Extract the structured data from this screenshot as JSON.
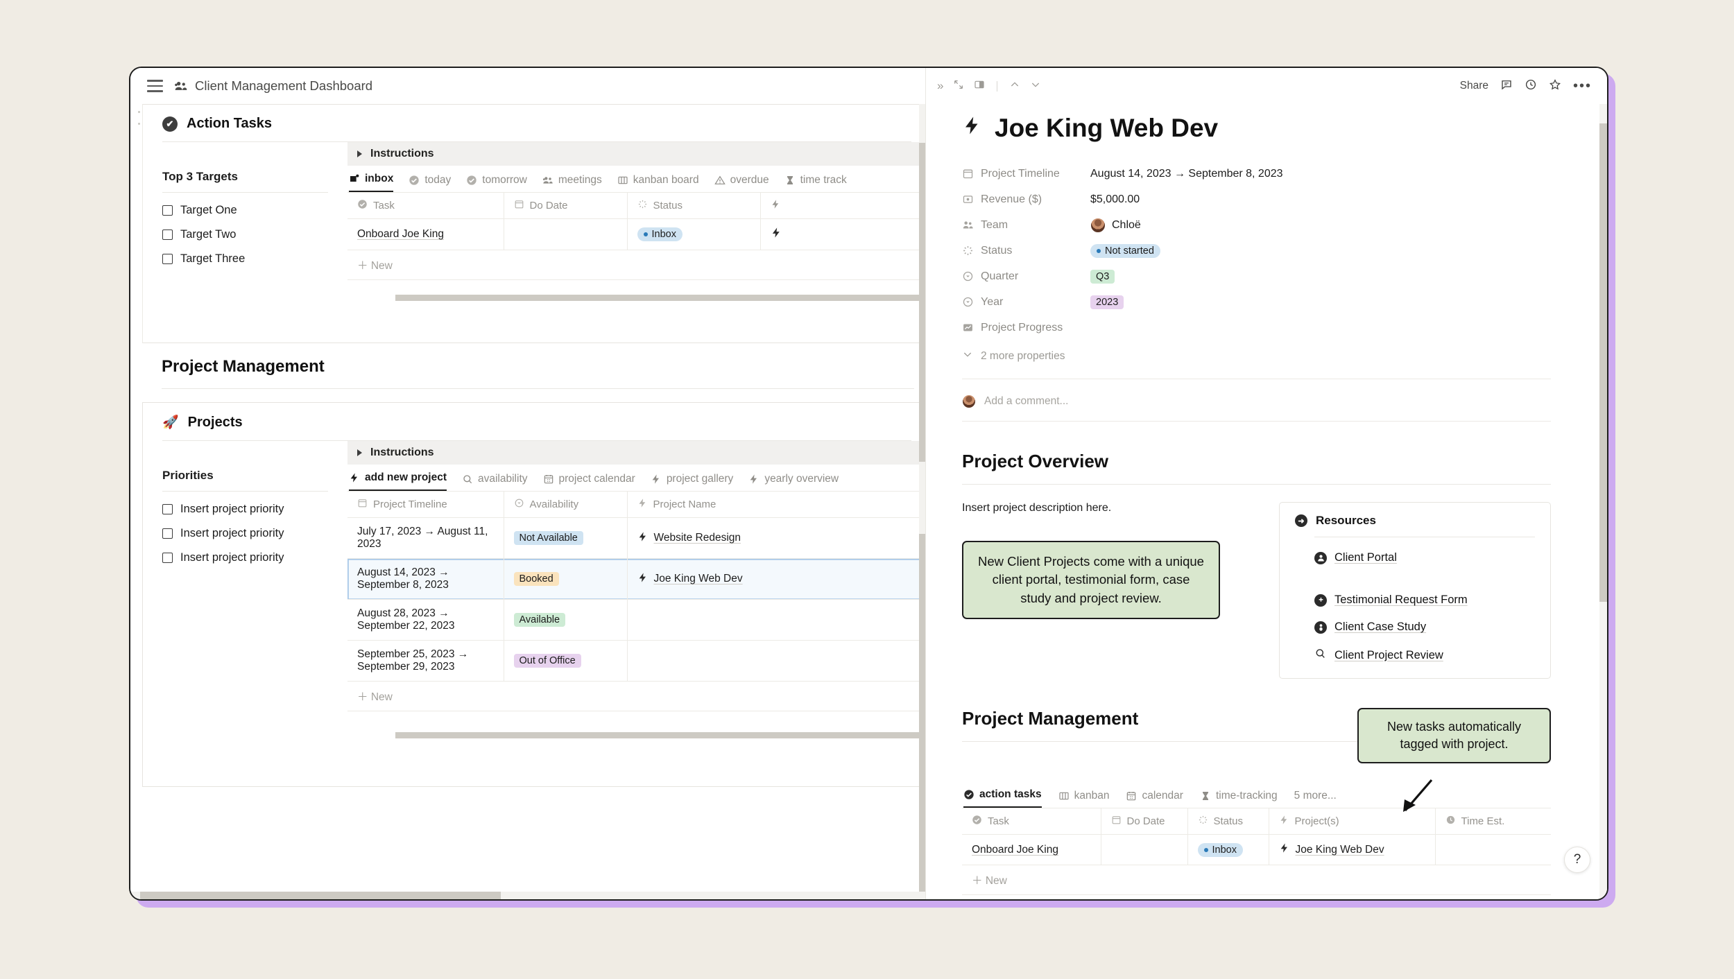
{
  "left_panel": {
    "topbar": {
      "title": "Client Management Dashboard",
      "menu_icon": "hamburger-icon",
      "title_icon": "people-icon"
    },
    "action_tasks": {
      "heading": "Action Tasks",
      "heading_icon": "check-circle-icon",
      "targets": {
        "title": "Top 3 Targets",
        "items": [
          "Target One",
          "Target Two",
          "Target Three"
        ]
      },
      "instructions_label": "Instructions",
      "tabs": [
        {
          "label": "inbox",
          "icon": "inbox-icon",
          "active": true
        },
        {
          "label": "today",
          "icon": "check-circle-icon",
          "active": false
        },
        {
          "label": "tomorrow",
          "icon": "check-circle-icon",
          "active": false
        },
        {
          "label": "meetings",
          "icon": "people-icon",
          "active": false
        },
        {
          "label": "kanban board",
          "icon": "columns-icon",
          "active": false
        },
        {
          "label": "overdue",
          "icon": "warning-icon",
          "active": false
        },
        {
          "label": "time track",
          "icon": "hourglass-icon",
          "active": false
        }
      ],
      "columns": [
        {
          "label": "Task",
          "icon": "check-circle-icon"
        },
        {
          "label": "Do Date",
          "icon": "calendar-icon"
        },
        {
          "label": "Status",
          "icon": "spinner-icon"
        },
        {
          "label": "",
          "icon": "bolt-icon"
        }
      ],
      "rows": [
        {
          "task": "Onboard Joe King",
          "do_date": "",
          "status": "Inbox",
          "project_icon": "bolt-icon"
        }
      ],
      "new_row_label": "New"
    },
    "project_management": {
      "heading": "Project Management",
      "projects_card": {
        "heading": "Projects",
        "heading_icon": "rocket-icon",
        "priorities": {
          "title": "Priorities",
          "items": [
            "Insert project priority",
            "Insert project priority",
            "Insert project priority"
          ]
        },
        "instructions_label": "Instructions",
        "tabs": [
          {
            "label": "add new project",
            "icon": "bolt-icon",
            "active": true
          },
          {
            "label": "availability",
            "icon": "search-icon",
            "active": false
          },
          {
            "label": "project calendar",
            "icon": "calendar-icon",
            "active": false
          },
          {
            "label": "project gallery",
            "icon": "bolt-icon",
            "active": false
          },
          {
            "label": "yearly overview",
            "icon": "bolt-icon",
            "active": false
          }
        ],
        "columns": [
          {
            "label": "Project Timeline",
            "icon": "calendar-icon"
          },
          {
            "label": "Availability",
            "icon": "select-icon"
          },
          {
            "label": "Project Name",
            "icon": "bolt-icon"
          }
        ],
        "rows": [
          {
            "timeline": "July 17, 2023 → August 11, 2023",
            "availability": "Not Available",
            "availability_color": "navail",
            "project": "Website Redesign",
            "selected": false
          },
          {
            "timeline": "August 14, 2023 → September 8, 2023",
            "availability": "Booked",
            "availability_color": "booked",
            "project": "Joe King Web Dev",
            "selected": true
          },
          {
            "timeline": "August 28, 2023 → September 22, 2023",
            "availability": "Available",
            "availability_color": "avail",
            "project": "",
            "selected": false
          },
          {
            "timeline": "September 25, 2023 → September 29, 2023",
            "availability": "Out of Office",
            "availability_color": "ooo",
            "project": "",
            "selected": false
          }
        ],
        "new_row_label": "New"
      }
    }
  },
  "right_panel": {
    "topbar": {
      "left_icons": [
        "expand-right-icon",
        "expand-diagonal-icon",
        "side-peek-icon",
        "chevron-up-icon",
        "chevron-down-icon"
      ],
      "share_label": "Share",
      "right_icons": [
        "comment-icon",
        "clock-icon",
        "star-icon",
        "more-icon"
      ]
    },
    "doc_title": "Joe King Web Dev",
    "doc_title_icon": "bolt-icon",
    "properties": [
      {
        "icon": "calendar-icon",
        "key": "Project Timeline",
        "value": "August 14, 2023 → September 8, 2023",
        "type": "text"
      },
      {
        "icon": "money-icon",
        "key": "Revenue ($)",
        "value": "$5,000.00",
        "type": "text"
      },
      {
        "icon": "people-icon",
        "key": "Team",
        "value": "Chloë",
        "type": "person"
      },
      {
        "icon": "spinner-icon",
        "key": "Status",
        "value": "Not started",
        "type": "pill-blue"
      },
      {
        "icon": "select-icon",
        "key": "Quarter",
        "value": "Q3",
        "type": "tag-green"
      },
      {
        "icon": "select-icon",
        "key": "Year",
        "value": "2023",
        "type": "tag-purple"
      },
      {
        "icon": "chart-icon",
        "key": "Project Progress",
        "value": "",
        "type": "text"
      }
    ],
    "more_properties_label": "2 more properties",
    "comment_placeholder": "Add a comment...",
    "project_overview": {
      "heading": "Project Overview",
      "description": "Insert project description here.",
      "callout": "New Client Projects come with a unique client portal, testimonial form, case study and project review.",
      "resources": {
        "heading": "Resources",
        "heading_icon": "arrow-circle-icon",
        "items": [
          {
            "label": "Client Portal",
            "icon": "person-circle-icon",
            "gap": false
          },
          {
            "label": "Testimonial Request Form",
            "icon": "plus-circle-icon",
            "gap": true
          },
          {
            "label": "Client Case Study",
            "icon": "person-badge-icon",
            "gap": false
          },
          {
            "label": "Client Project Review",
            "icon": "search-icon",
            "gap": false
          }
        ]
      }
    },
    "project_management": {
      "heading": "Project Management",
      "callout": "New tasks automatically tagged with project.",
      "tabs": [
        {
          "label": "action tasks",
          "icon": "check-circle-icon",
          "active": true
        },
        {
          "label": "kanban",
          "icon": "columns-icon",
          "active": false
        },
        {
          "label": "calendar",
          "icon": "calendar-icon",
          "active": false
        },
        {
          "label": "time-tracking",
          "icon": "hourglass-icon",
          "active": false
        },
        {
          "label": "5 more...",
          "icon": "",
          "active": false
        }
      ],
      "columns": [
        {
          "label": "Task",
          "icon": "check-circle-icon"
        },
        {
          "label": "Do Date",
          "icon": "calendar-icon"
        },
        {
          "label": "Status",
          "icon": "spinner-icon"
        },
        {
          "label": "Project(s)",
          "icon": "bolt-icon"
        },
        {
          "label": "Time Est.",
          "icon": "clock-icon"
        }
      ],
      "rows": [
        {
          "task": "Onboard Joe King",
          "do_date": "",
          "status": "Inbox",
          "projects": "Joe King Web Dev",
          "time_est": ""
        }
      ],
      "new_row_label": "New"
    },
    "help_button_label": "?"
  },
  "colors": {
    "page_background": "#f0ece4",
    "window_shadow": "#cdaaf0",
    "callout_green": "#d9e7ce",
    "pill_blue": "#cfe3f2",
    "tag_booked": "#fae3bd",
    "tag_available": "#cdebd4",
    "tag_out_of_office": "#e7d2ee"
  }
}
